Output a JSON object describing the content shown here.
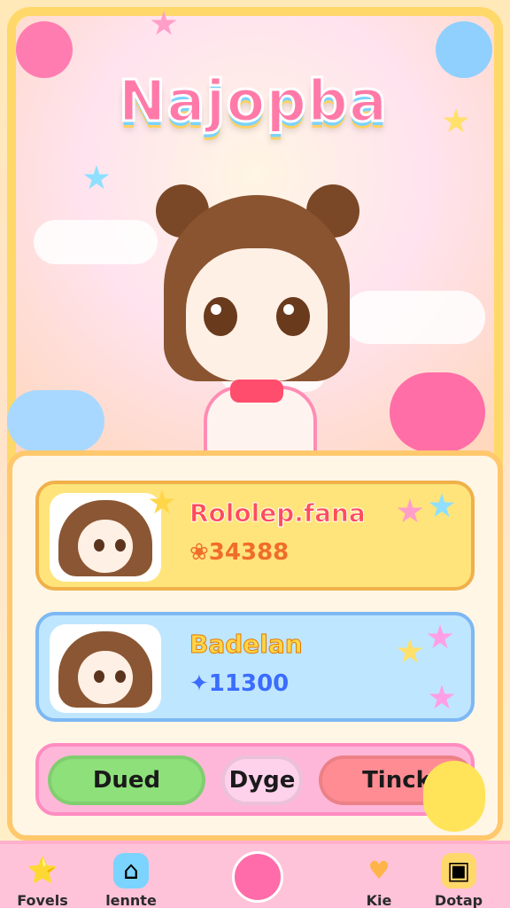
{
  "title": "Najopba",
  "hero": {
    "character_icon": "girl-character-icon"
  },
  "players": [
    {
      "name": "Rololep.fana",
      "score": "34388",
      "score_icon": "coin-icon"
    },
    {
      "name": "Badelan",
      "score": "11300",
      "score_icon": "gem-icon"
    }
  ],
  "actions": {
    "left": "Dued",
    "middle": "Dyge",
    "right": "Tinck"
  },
  "nav": [
    {
      "label": "Fovels",
      "icon": "star-icon"
    },
    {
      "label": "lennte",
      "icon": "house-icon"
    },
    {
      "label": "",
      "icon": "smiley-orb-icon"
    },
    {
      "label": "Kie",
      "icon": "heart-icon"
    },
    {
      "label": "Dotap",
      "icon": "box-icon"
    }
  ],
  "colors": {
    "accent": "#ff7aa8",
    "gold": "#ffd86a",
    "blue": "#7bd3ff"
  }
}
